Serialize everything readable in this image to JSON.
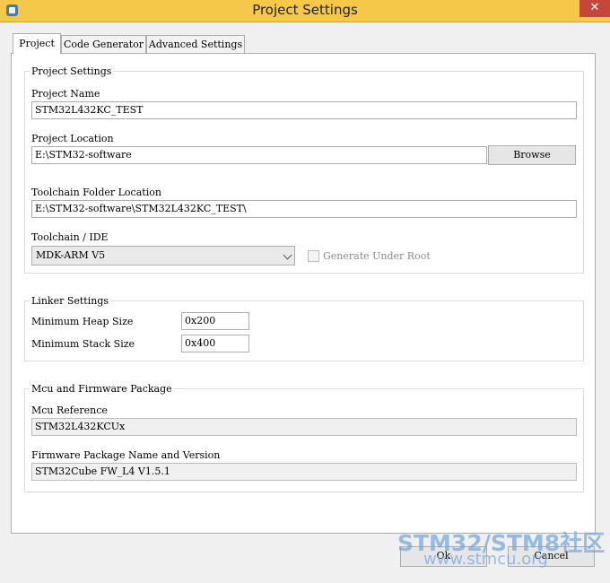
{
  "window": {
    "title": "Project Settings",
    "close_glyph": "✕",
    "icon": "app-cube-icon"
  },
  "tabs": [
    {
      "label": "Project",
      "active": true
    },
    {
      "label": "Code Generator",
      "active": false
    },
    {
      "label": "Advanced Settings",
      "active": false
    }
  ],
  "project_settings": {
    "legend": "Project Settings",
    "project_name_label": "Project Name",
    "project_name_value": "STM32L432KC_TEST",
    "project_location_label": "Project Location",
    "project_location_value": "E:\\STM32-software",
    "browse_label": "Browse",
    "toolchain_folder_label": "Toolchain Folder Location",
    "toolchain_folder_value": "E:\\STM32-software\\STM32L432KC_TEST\\",
    "toolchain_ide_label": "Toolchain / IDE",
    "toolchain_ide_value": "MDK-ARM V5",
    "generate_under_root_label": "Generate Under Root",
    "generate_under_root_checked": false
  },
  "linker_settings": {
    "legend": "Linker Settings",
    "min_heap_label": "Minimum Heap Size",
    "min_heap_value": "0x200",
    "min_stack_label": "Minimum Stack Size",
    "min_stack_value": "0x400"
  },
  "mcu_firmware": {
    "legend": "Mcu and Firmware Package",
    "mcu_reference_label": "Mcu Reference",
    "mcu_reference_value": "STM32L432KCUx",
    "firmware_label": "Firmware Package Name and Version",
    "firmware_value": "STM32Cube FW_L4 V1.5.1"
  },
  "buttons": {
    "ok_label": "Ok",
    "cancel_label": "Cancel"
  },
  "watermark": {
    "line1": "STM32/STM8社区",
    "line2": "www.stmcu.org"
  },
  "colors": {
    "titlebar": "#f5c84a",
    "close_button": "#c7463a",
    "watermark": "#78aadc"
  }
}
